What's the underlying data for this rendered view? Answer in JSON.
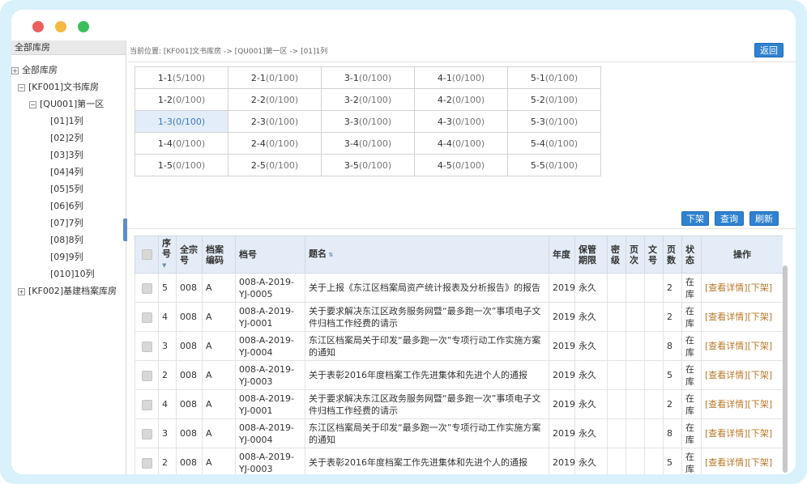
{
  "sidebar": {
    "header": "全部库房",
    "tree": [
      {
        "label": "全部库房",
        "toggle": "+",
        "level": 0
      },
      {
        "label": "[KF001]文书库房",
        "toggle": "−",
        "level": 1
      },
      {
        "label": "[QU001]第一区",
        "toggle": "−",
        "level": 2
      },
      {
        "label": "[01]1列",
        "toggle": "",
        "level": 3
      },
      {
        "label": "[02]2列",
        "toggle": "",
        "level": 3
      },
      {
        "label": "[03]3列",
        "toggle": "",
        "level": 3
      },
      {
        "label": "[04]4列",
        "toggle": "",
        "level": 3
      },
      {
        "label": "[05]5列",
        "toggle": "",
        "level": 3
      },
      {
        "label": "[06]6列",
        "toggle": "",
        "level": 3
      },
      {
        "label": "[07]7列",
        "toggle": "",
        "level": 3
      },
      {
        "label": "[08]8列",
        "toggle": "",
        "level": 3
      },
      {
        "label": "[09]9列",
        "toggle": "",
        "level": 3
      },
      {
        "label": "[010]10列",
        "toggle": "",
        "level": 3
      },
      {
        "label": "[KF002]基建档案库房",
        "toggle": "+",
        "level": 1
      }
    ]
  },
  "breadcrumb": "当前位置: [KF001]文书库房 -> [QU001]第一区 -> [01]1列",
  "buttons": {
    "back": "返回",
    "unshelve": "下架",
    "query": "查询",
    "refresh": "刷新"
  },
  "cells": [
    [
      {
        "n": "1-1",
        "c": "(5/100)"
      },
      {
        "n": "2-1",
        "c": "(0/100)"
      },
      {
        "n": "3-1",
        "c": "(0/100)"
      },
      {
        "n": "4-1",
        "c": "(0/100)"
      },
      {
        "n": "5-1",
        "c": "(0/100)"
      }
    ],
    [
      {
        "n": "1-2",
        "c": "(0/100)"
      },
      {
        "n": "2-2",
        "c": "(0/100)"
      },
      {
        "n": "3-2",
        "c": "(0/100)"
      },
      {
        "n": "4-2",
        "c": "(0/100)"
      },
      {
        "n": "5-2",
        "c": "(0/100)"
      }
    ],
    [
      {
        "n": "1-3",
        "c": "(0/100)",
        "selected": true
      },
      {
        "n": "2-3",
        "c": "(0/100)"
      },
      {
        "n": "3-3",
        "c": "(0/100)"
      },
      {
        "n": "4-3",
        "c": "(0/100)"
      },
      {
        "n": "5-3",
        "c": "(0/100)"
      }
    ],
    [
      {
        "n": "1-4",
        "c": "(0/100)"
      },
      {
        "n": "2-4",
        "c": "(0/100)"
      },
      {
        "n": "3-4",
        "c": "(0/100)"
      },
      {
        "n": "4-4",
        "c": "(0/100)"
      },
      {
        "n": "5-4",
        "c": "(0/100)"
      }
    ],
    [
      {
        "n": "1-5",
        "c": "(0/100)"
      },
      {
        "n": "2-5",
        "c": "(0/100)"
      },
      {
        "n": "3-5",
        "c": "(0/100)"
      },
      {
        "n": "4-5",
        "c": "(0/100)"
      },
      {
        "n": "5-5",
        "c": "(0/100)"
      }
    ]
  ],
  "table": {
    "headers": [
      "",
      "序号",
      "全宗号",
      "档案编码",
      "档号",
      "题名",
      "年度",
      "保管期限",
      "密级",
      "页次",
      "文号",
      "页数",
      "状态",
      "操作"
    ],
    "rows": [
      {
        "seq": "5",
        "fonds": "008",
        "code": "A",
        "num": "008-A-2019-YJ-0005",
        "title": "关于上报《东江区档案局资产统计报表及分析报告》的报告",
        "year": "2019",
        "period": "永久",
        "secret": "",
        "page": "",
        "doc": "",
        "pages": "2",
        "status": "在库"
      },
      {
        "seq": "4",
        "fonds": "008",
        "code": "A",
        "num": "008-A-2019-YJ-0001",
        "title": "关于要求解决东江区政务服务网暨“最多跑一次”事项电子文件归档工作经费的请示",
        "year": "2019",
        "period": "永久",
        "secret": "",
        "page": "",
        "doc": "",
        "pages": "2",
        "status": "在库"
      },
      {
        "seq": "3",
        "fonds": "008",
        "code": "A",
        "num": "008-A-2019-YJ-0004",
        "title": "东江区档案局关于印发“最多跑一次”专项行动工作实施方案的通知",
        "year": "2019",
        "period": "永久",
        "secret": "",
        "page": "",
        "doc": "",
        "pages": "8",
        "status": "在库"
      },
      {
        "seq": "2",
        "fonds": "008",
        "code": "A",
        "num": "008-A-2019-YJ-0003",
        "title": "关于表彰2016年度档案工作先进集体和先进个人的通报",
        "year": "2019",
        "period": "永久",
        "secret": "",
        "page": "",
        "doc": "",
        "pages": "5",
        "status": "在库"
      },
      {
        "seq": "4",
        "fonds": "008",
        "code": "A",
        "num": "008-A-2019-YJ-0001",
        "title": "关于要求解决东江区政务服务网暨“最多跑一次”事项电子文件归档工作经费的请示",
        "year": "2019",
        "period": "永久",
        "secret": "",
        "page": "",
        "doc": "",
        "pages": "2",
        "status": "在库"
      },
      {
        "seq": "3",
        "fonds": "008",
        "code": "A",
        "num": "008-A-2019-YJ-0004",
        "title": "东江区档案局关于印发“最多跑一次”专项行动工作实施方案的通知",
        "year": "2019",
        "period": "永久",
        "secret": "",
        "page": "",
        "doc": "",
        "pages": "8",
        "status": "在库"
      },
      {
        "seq": "2",
        "fonds": "008",
        "code": "A",
        "num": "008-A-2019-YJ-0003",
        "title": "关于表彰2016年度档案工作先进集体和先进个人的通报",
        "year": "2019",
        "period": "永久",
        "secret": "",
        "page": "",
        "doc": "",
        "pages": "5",
        "status": "在库"
      },
      {
        "seq": "",
        "fonds": "",
        "code": "",
        "num": "008-A-2019-YJ-",
        "title": "",
        "year": "",
        "period": "",
        "secret": "",
        "page": "",
        "doc": "",
        "pages": "",
        "status": "在"
      }
    ],
    "op_detail": "[查看详情]",
    "op_unshelve": "[下架]"
  }
}
